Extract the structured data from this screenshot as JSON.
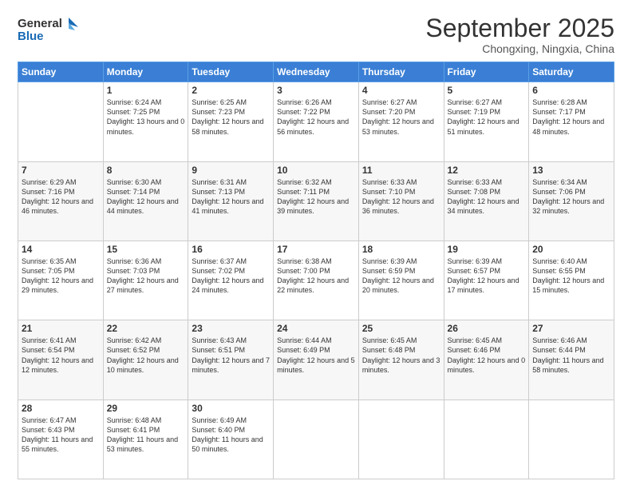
{
  "logo": {
    "line1": "General",
    "line2": "Blue"
  },
  "title": "September 2025",
  "subtitle": "Chongxing, Ningxia, China",
  "days_header": [
    "Sunday",
    "Monday",
    "Tuesday",
    "Wednesday",
    "Thursday",
    "Friday",
    "Saturday"
  ],
  "weeks": [
    [
      {
        "day": "",
        "sunrise": "",
        "sunset": "",
        "daylight": ""
      },
      {
        "day": "1",
        "sunrise": "Sunrise: 6:24 AM",
        "sunset": "Sunset: 7:25 PM",
        "daylight": "Daylight: 13 hours and 0 minutes."
      },
      {
        "day": "2",
        "sunrise": "Sunrise: 6:25 AM",
        "sunset": "Sunset: 7:23 PM",
        "daylight": "Daylight: 12 hours and 58 minutes."
      },
      {
        "day": "3",
        "sunrise": "Sunrise: 6:26 AM",
        "sunset": "Sunset: 7:22 PM",
        "daylight": "Daylight: 12 hours and 56 minutes."
      },
      {
        "day": "4",
        "sunrise": "Sunrise: 6:27 AM",
        "sunset": "Sunset: 7:20 PM",
        "daylight": "Daylight: 12 hours and 53 minutes."
      },
      {
        "day": "5",
        "sunrise": "Sunrise: 6:27 AM",
        "sunset": "Sunset: 7:19 PM",
        "daylight": "Daylight: 12 hours and 51 minutes."
      },
      {
        "day": "6",
        "sunrise": "Sunrise: 6:28 AM",
        "sunset": "Sunset: 7:17 PM",
        "daylight": "Daylight: 12 hours and 48 minutes."
      }
    ],
    [
      {
        "day": "7",
        "sunrise": "Sunrise: 6:29 AM",
        "sunset": "Sunset: 7:16 PM",
        "daylight": "Daylight: 12 hours and 46 minutes."
      },
      {
        "day": "8",
        "sunrise": "Sunrise: 6:30 AM",
        "sunset": "Sunset: 7:14 PM",
        "daylight": "Daylight: 12 hours and 44 minutes."
      },
      {
        "day": "9",
        "sunrise": "Sunrise: 6:31 AM",
        "sunset": "Sunset: 7:13 PM",
        "daylight": "Daylight: 12 hours and 41 minutes."
      },
      {
        "day": "10",
        "sunrise": "Sunrise: 6:32 AM",
        "sunset": "Sunset: 7:11 PM",
        "daylight": "Daylight: 12 hours and 39 minutes."
      },
      {
        "day": "11",
        "sunrise": "Sunrise: 6:33 AM",
        "sunset": "Sunset: 7:10 PM",
        "daylight": "Daylight: 12 hours and 36 minutes."
      },
      {
        "day": "12",
        "sunrise": "Sunrise: 6:33 AM",
        "sunset": "Sunset: 7:08 PM",
        "daylight": "Daylight: 12 hours and 34 minutes."
      },
      {
        "day": "13",
        "sunrise": "Sunrise: 6:34 AM",
        "sunset": "Sunset: 7:06 PM",
        "daylight": "Daylight: 12 hours and 32 minutes."
      }
    ],
    [
      {
        "day": "14",
        "sunrise": "Sunrise: 6:35 AM",
        "sunset": "Sunset: 7:05 PM",
        "daylight": "Daylight: 12 hours and 29 minutes."
      },
      {
        "day": "15",
        "sunrise": "Sunrise: 6:36 AM",
        "sunset": "Sunset: 7:03 PM",
        "daylight": "Daylight: 12 hours and 27 minutes."
      },
      {
        "day": "16",
        "sunrise": "Sunrise: 6:37 AM",
        "sunset": "Sunset: 7:02 PM",
        "daylight": "Daylight: 12 hours and 24 minutes."
      },
      {
        "day": "17",
        "sunrise": "Sunrise: 6:38 AM",
        "sunset": "Sunset: 7:00 PM",
        "daylight": "Daylight: 12 hours and 22 minutes."
      },
      {
        "day": "18",
        "sunrise": "Sunrise: 6:39 AM",
        "sunset": "Sunset: 6:59 PM",
        "daylight": "Daylight: 12 hours and 20 minutes."
      },
      {
        "day": "19",
        "sunrise": "Sunrise: 6:39 AM",
        "sunset": "Sunset: 6:57 PM",
        "daylight": "Daylight: 12 hours and 17 minutes."
      },
      {
        "day": "20",
        "sunrise": "Sunrise: 6:40 AM",
        "sunset": "Sunset: 6:55 PM",
        "daylight": "Daylight: 12 hours and 15 minutes."
      }
    ],
    [
      {
        "day": "21",
        "sunrise": "Sunrise: 6:41 AM",
        "sunset": "Sunset: 6:54 PM",
        "daylight": "Daylight: 12 hours and 12 minutes."
      },
      {
        "day": "22",
        "sunrise": "Sunrise: 6:42 AM",
        "sunset": "Sunset: 6:52 PM",
        "daylight": "Daylight: 12 hours and 10 minutes."
      },
      {
        "day": "23",
        "sunrise": "Sunrise: 6:43 AM",
        "sunset": "Sunset: 6:51 PM",
        "daylight": "Daylight: 12 hours and 7 minutes."
      },
      {
        "day": "24",
        "sunrise": "Sunrise: 6:44 AM",
        "sunset": "Sunset: 6:49 PM",
        "daylight": "Daylight: 12 hours and 5 minutes."
      },
      {
        "day": "25",
        "sunrise": "Sunrise: 6:45 AM",
        "sunset": "Sunset: 6:48 PM",
        "daylight": "Daylight: 12 hours and 3 minutes."
      },
      {
        "day": "26",
        "sunrise": "Sunrise: 6:45 AM",
        "sunset": "Sunset: 6:46 PM",
        "daylight": "Daylight: 12 hours and 0 minutes."
      },
      {
        "day": "27",
        "sunrise": "Sunrise: 6:46 AM",
        "sunset": "Sunset: 6:44 PM",
        "daylight": "Daylight: 11 hours and 58 minutes."
      }
    ],
    [
      {
        "day": "28",
        "sunrise": "Sunrise: 6:47 AM",
        "sunset": "Sunset: 6:43 PM",
        "daylight": "Daylight: 11 hours and 55 minutes."
      },
      {
        "day": "29",
        "sunrise": "Sunrise: 6:48 AM",
        "sunset": "Sunset: 6:41 PM",
        "daylight": "Daylight: 11 hours and 53 minutes."
      },
      {
        "day": "30",
        "sunrise": "Sunrise: 6:49 AM",
        "sunset": "Sunset: 6:40 PM",
        "daylight": "Daylight: 11 hours and 50 minutes."
      },
      {
        "day": "",
        "sunrise": "",
        "sunset": "",
        "daylight": ""
      },
      {
        "day": "",
        "sunrise": "",
        "sunset": "",
        "daylight": ""
      },
      {
        "day": "",
        "sunrise": "",
        "sunset": "",
        "daylight": ""
      },
      {
        "day": "",
        "sunrise": "",
        "sunset": "",
        "daylight": ""
      }
    ]
  ]
}
